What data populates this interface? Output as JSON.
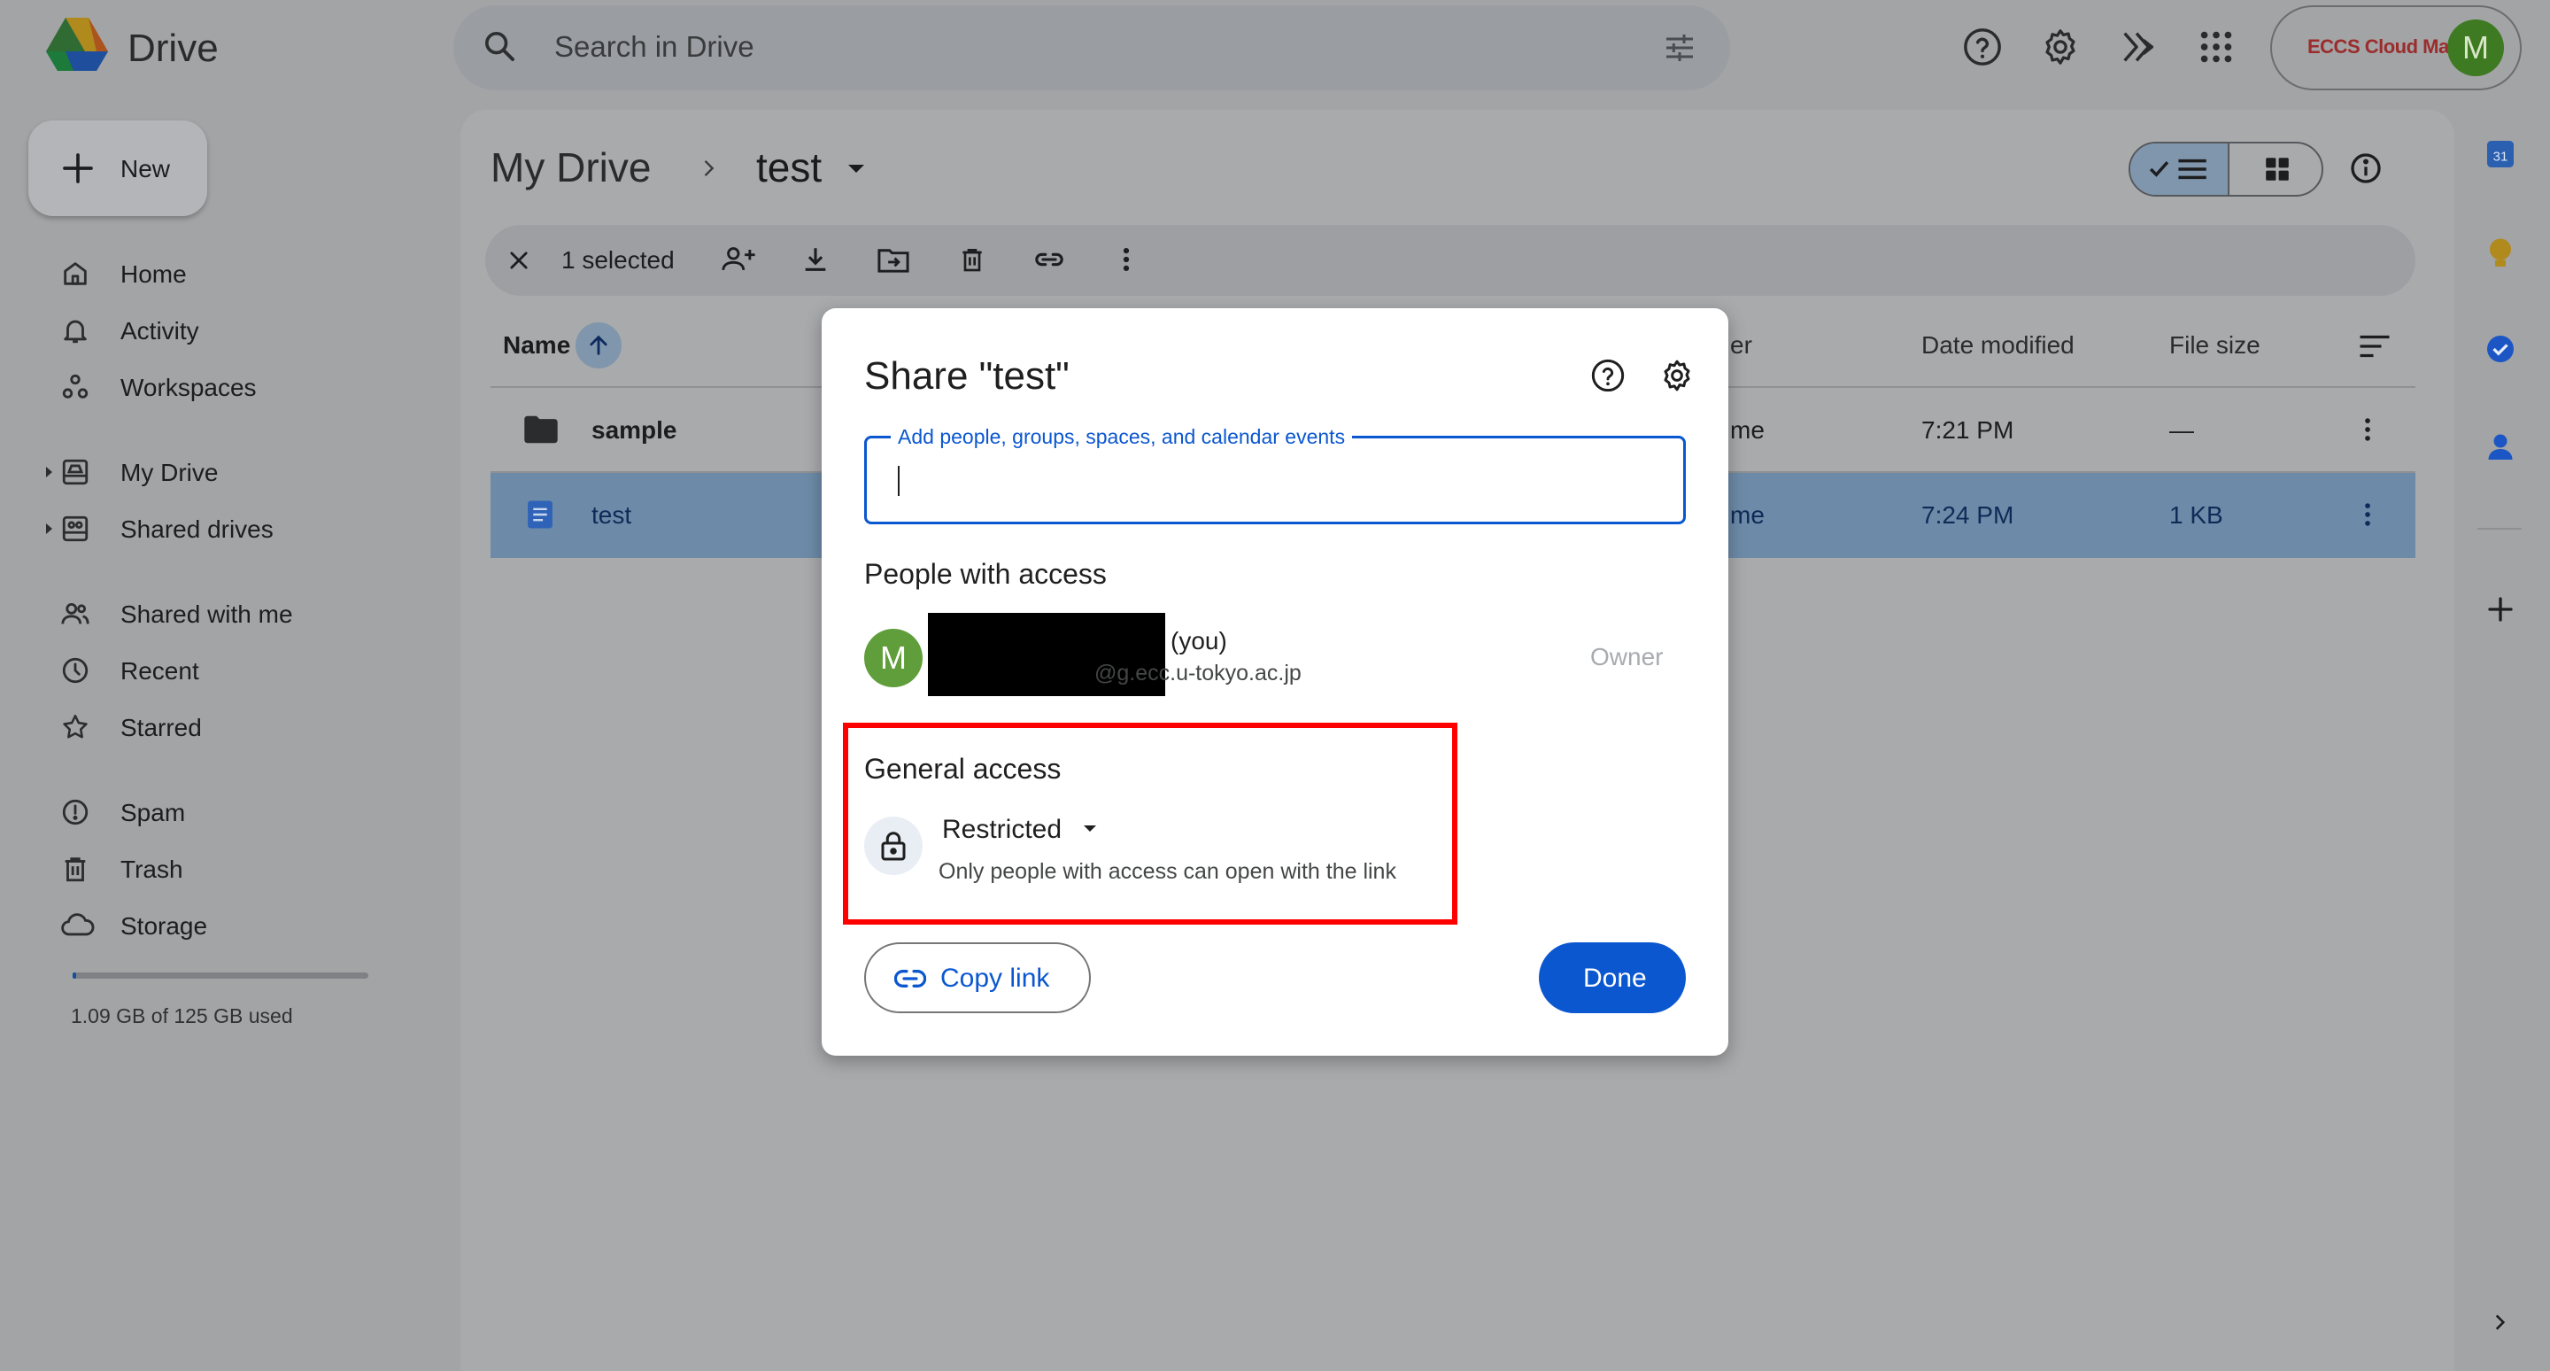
{
  "app": {
    "name": "Drive",
    "search_placeholder": "Search in Drive",
    "account_label": "ECCS Cloud Mail",
    "avatar_letter": "M"
  },
  "sidebar": {
    "new_label": "New",
    "items": [
      {
        "label": "Home",
        "icon": "home-icon"
      },
      {
        "label": "Activity",
        "icon": "bell-icon"
      },
      {
        "label": "Workspaces",
        "icon": "workspaces-icon"
      },
      {
        "label": "My Drive",
        "icon": "my-drive-icon"
      },
      {
        "label": "Shared drives",
        "icon": "shared-drives-icon"
      },
      {
        "label": "Shared with me",
        "icon": "people-icon"
      },
      {
        "label": "Recent",
        "icon": "clock-icon"
      },
      {
        "label": "Starred",
        "icon": "star-icon"
      },
      {
        "label": "Spam",
        "icon": "spam-icon"
      },
      {
        "label": "Trash",
        "icon": "trash-icon"
      },
      {
        "label": "Storage",
        "icon": "cloud-icon"
      }
    ],
    "storage_text": "1.09 GB of 125 GB used",
    "storage_fraction": 0.0087
  },
  "breadcrumb": {
    "root": "My Drive",
    "current": "test"
  },
  "selection": {
    "count_label": "1 selected"
  },
  "table": {
    "headers": {
      "name": "Name",
      "owner_partial": "er",
      "date_modified": "Date modified",
      "file_size": "File size"
    },
    "rows": [
      {
        "name": "sample",
        "type": "folder",
        "owner_partial": "me",
        "modified": "7:21 PM",
        "size": "—"
      },
      {
        "name": "test",
        "type": "doc",
        "owner_partial": "me",
        "modified": "7:24 PM",
        "size": "1 KB"
      }
    ]
  },
  "dialog": {
    "title": "Share \"test\"",
    "input_label": "Add people, groups, spaces, and calendar events",
    "people_heading": "People with access",
    "person": {
      "avatar_letter": "M",
      "you_label": "(you)",
      "email_suffix": "@g.ecc.u-tokyo.ac.jp",
      "role": "Owner"
    },
    "general_heading": "General access",
    "access_level": "Restricted",
    "access_desc": "Only people with access can open with the link",
    "copy_link": "Copy link",
    "done": "Done"
  },
  "rail": {
    "calendar_day": "31"
  },
  "colors": {
    "accent": "#0b57d0",
    "highlight": "#ff0000",
    "selected_row": "#6d8ba8"
  }
}
